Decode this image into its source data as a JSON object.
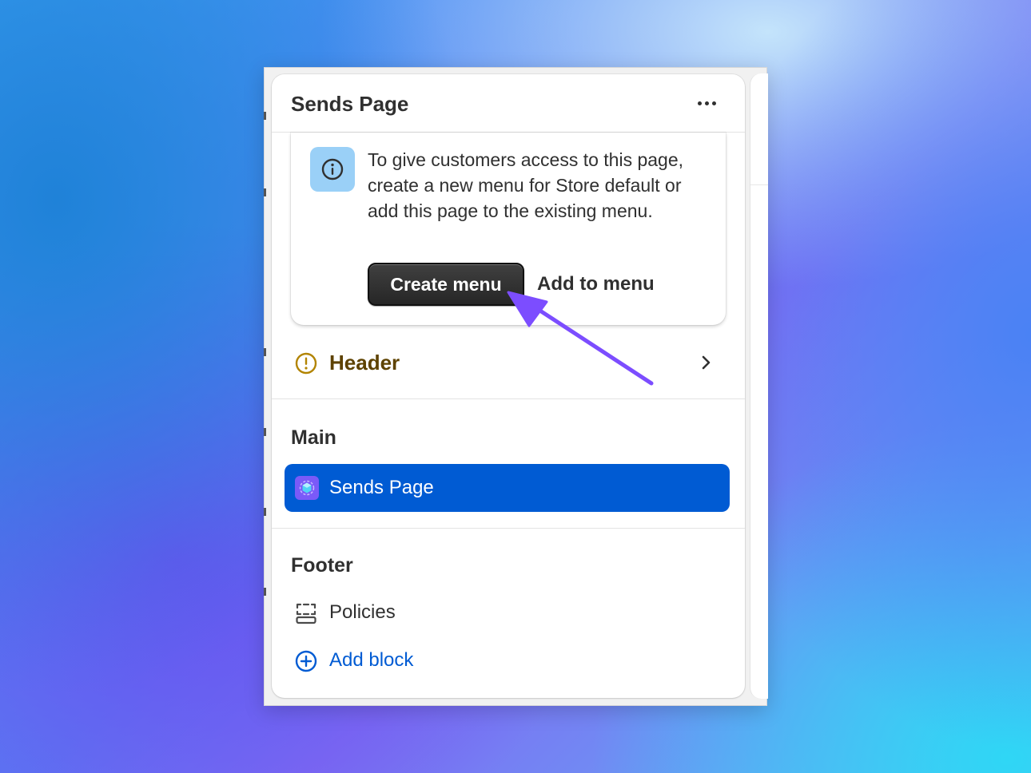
{
  "panel": {
    "title": "Sends Page",
    "more_icon": "more-horizontal-icon"
  },
  "banner": {
    "icon": "info-icon",
    "message": "To give customers access to this page, create a new menu for Store default or add this page to the existing menu.",
    "primary_label": "Create menu",
    "secondary_label": "Add to menu"
  },
  "header_section": {
    "label": "Header",
    "status_icon": "alert-circle-icon",
    "chevron_icon": "chevron-right-icon"
  },
  "main_section": {
    "title": "Main",
    "selected_item": {
      "label": "Sends Page",
      "icon": "app-block-icon"
    }
  },
  "footer_section": {
    "title": "Footer",
    "items": [
      {
        "label": "Policies",
        "icon": "section-icon"
      }
    ],
    "add_block_label": "Add block",
    "add_block_icon": "plus-circle-icon"
  },
  "annotation": {
    "arrow_icon": "pointer-arrow-icon",
    "arrow_color": "#7c4dff"
  },
  "colors": {
    "primary_blue": "#005bd3",
    "warning_text": "#5e4200",
    "warning_icon": "#b28400",
    "info_bg": "#9ad0f7",
    "button_dark": "#303030"
  }
}
